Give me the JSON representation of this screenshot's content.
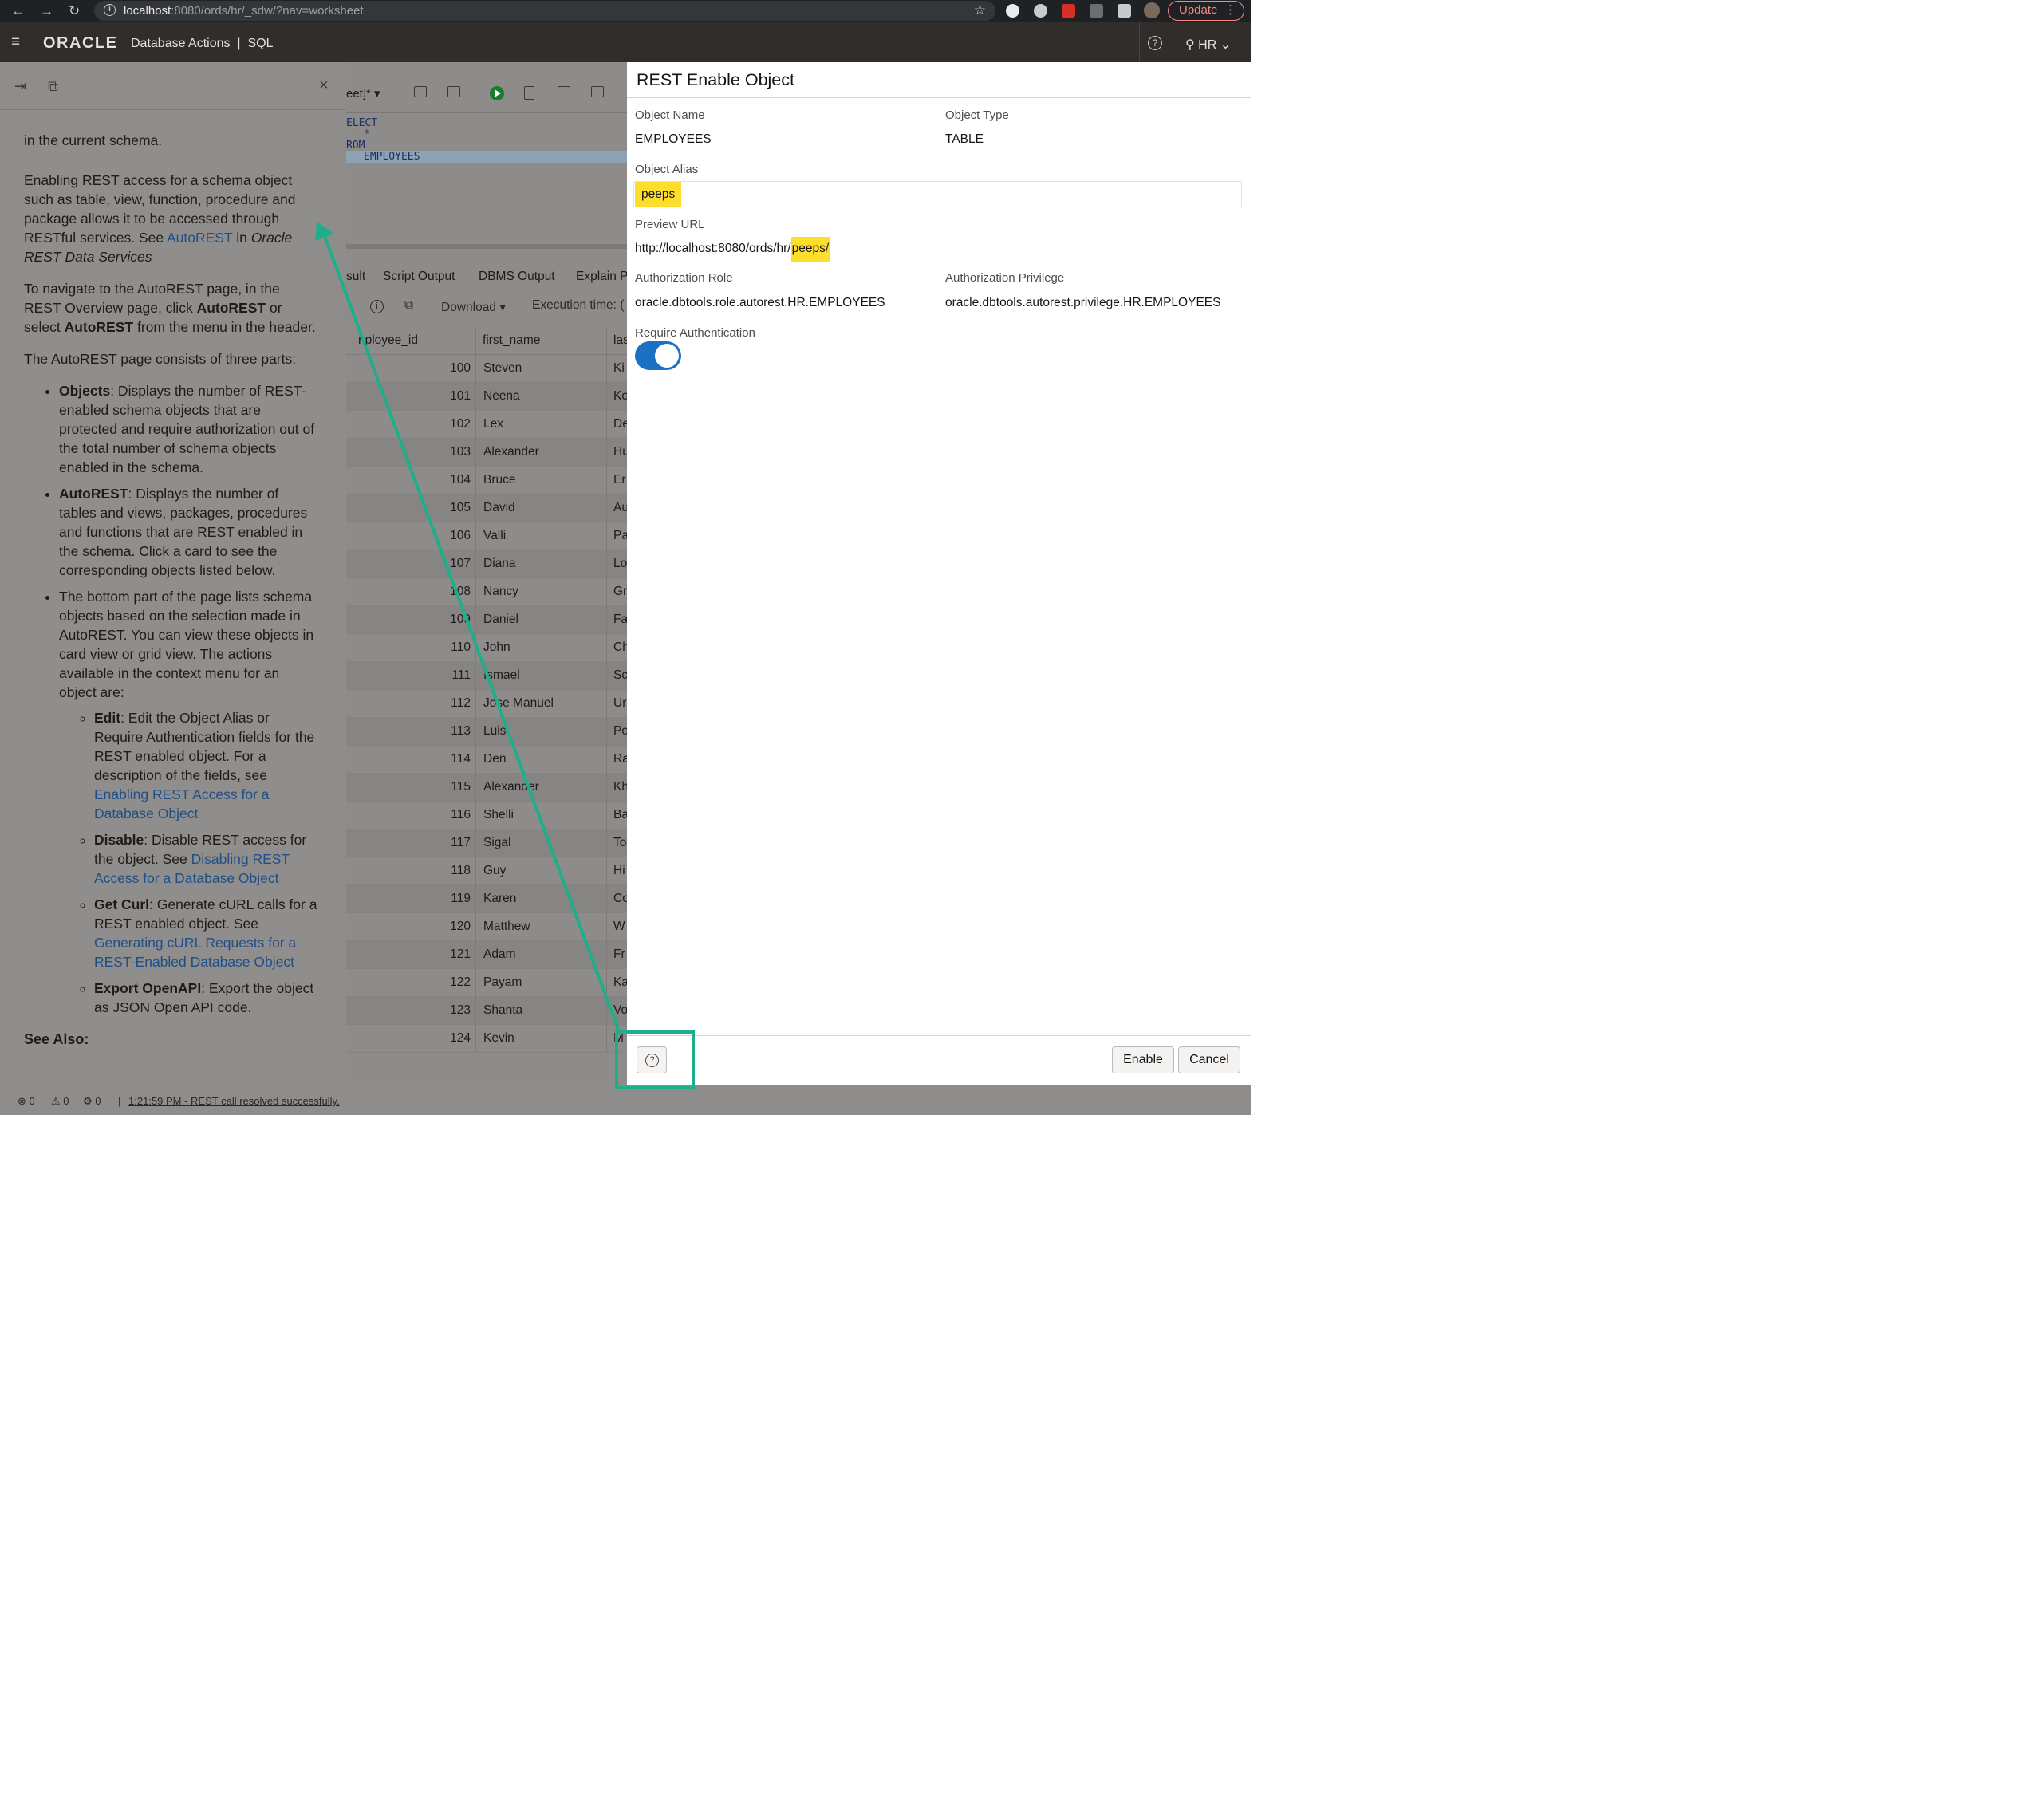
{
  "browser": {
    "url_host": "localhost",
    "url_rest": ":8080/ords/hr/_sdw/?nav=worksheet",
    "update_label": "Update"
  },
  "app": {
    "logo": "ORACLE",
    "product": "Database Actions",
    "section": "SQL",
    "user": "HR"
  },
  "help_panel": {
    "cut_line": "in the current schema.",
    "p1_a": "Enabling REST access for a schema object such as table, view, function, procedure and package allows it to be accessed through RESTful services. See ",
    "p1_link": "AutoREST",
    "p1_b": " in ",
    "p1_em": "Oracle REST Data Services",
    "p2_a": "To navigate to the AutoREST page, in the REST Overview page, click ",
    "p2_b1": "AutoREST",
    "p2_c": " or select ",
    "p2_b2": "AutoREST",
    "p2_d": " from the menu in the header.",
    "p3": "The AutoREST page consists of three parts:",
    "li1_b": "Objects",
    "li1": ": Displays the number of REST-enabled schema objects that are protected and require authorization out of the total number of schema objects enabled in the schema.",
    "li2_b": "AutoREST",
    "li2": ": Displays the number of tables and views, packages, procedures and functions that are REST enabled in the schema. Click a card to see the corresponding objects listed below.",
    "li3": "The bottom part of the page lists schema objects based on the selection made in AutoREST. You can view these objects in card view or grid view. The actions available in the context menu for an object are:",
    "sub1_b": "Edit",
    "sub1": ": Edit the Object Alias or Require Authentication fields for the REST enabled object. For a description of the fields, see ",
    "sub1_link": "Enabling REST Access for a Database Object",
    "sub2_b": "Disable",
    "sub2": ": Disable REST access for the object. See ",
    "sub2_link": "Disabling REST Access for a Database Object",
    "sub3_b": "Get Curl",
    "sub3": ": Generate cURL calls for a REST enabled object. See ",
    "sub3_link": "Generating cURL Requests for a REST-Enabled Database Object",
    "sub4_b": "Export OpenAPI",
    "sub4": ": Export the object as JSON Open API code.",
    "see_also": "See Also:"
  },
  "worksheet": {
    "tab_label": "eet]*",
    "code": [
      "ELECT",
      "*",
      "ROM",
      "EMPLOYEES"
    ],
    "result_tabs": [
      "sult",
      "Script Output",
      "DBMS Output",
      "Explain P"
    ],
    "download_label": "Download",
    "exec_time_label": "Execution time: (",
    "columns": [
      "nployee_id",
      "first_name",
      "las"
    ],
    "rows": [
      {
        "id": "100",
        "name": "Steven",
        "last": "Ki"
      },
      {
        "id": "101",
        "name": "Neena",
        "last": "Ko"
      },
      {
        "id": "102",
        "name": "Lex",
        "last": "De"
      },
      {
        "id": "103",
        "name": "Alexander",
        "last": "Hu"
      },
      {
        "id": "104",
        "name": "Bruce",
        "last": "Er"
      },
      {
        "id": "105",
        "name": "David",
        "last": "Au"
      },
      {
        "id": "106",
        "name": "Valli",
        "last": "Pa"
      },
      {
        "id": "107",
        "name": "Diana",
        "last": "Lo"
      },
      {
        "id": "108",
        "name": "Nancy",
        "last": "Gr"
      },
      {
        "id": "109",
        "name": "Daniel",
        "last": "Fa"
      },
      {
        "id": "110",
        "name": "John",
        "last": "Ch"
      },
      {
        "id": "111",
        "name": "Ismael",
        "last": "Sc"
      },
      {
        "id": "112",
        "name": "Jose Manuel",
        "last": "Ur"
      },
      {
        "id": "113",
        "name": "Luis",
        "last": "Po"
      },
      {
        "id": "114",
        "name": "Den",
        "last": "Ra"
      },
      {
        "id": "115",
        "name": "Alexander",
        "last": "Kh"
      },
      {
        "id": "116",
        "name": "Shelli",
        "last": "Ba"
      },
      {
        "id": "117",
        "name": "Sigal",
        "last": "To"
      },
      {
        "id": "118",
        "name": "Guy",
        "last": "Hi"
      },
      {
        "id": "119",
        "name": "Karen",
        "last": "Co"
      },
      {
        "id": "120",
        "name": "Matthew",
        "last": "W"
      },
      {
        "id": "121",
        "name": "Adam",
        "last": "Fr"
      },
      {
        "id": "122",
        "name": "Payam",
        "last": "Ka"
      },
      {
        "id": "123",
        "name": "Shanta",
        "last": "Vo"
      },
      {
        "id": "124",
        "name": "Kevin",
        "last": "M"
      }
    ]
  },
  "dialog": {
    "title": "REST Enable Object",
    "object_name_label": "Object Name",
    "object_name": "EMPLOYEES",
    "object_type_label": "Object Type",
    "object_type": "TABLE",
    "alias_label": "Object Alias",
    "alias_value": "peeps",
    "preview_url_label": "Preview URL",
    "preview_url_base": "http://localhost:8080/ords/hr/",
    "preview_url_alias": "peeps/",
    "auth_role_label": "Authorization Role",
    "auth_role": "oracle.dbtools.role.autorest.HR.EMPLOYEES",
    "auth_priv_label": "Authorization Privilege",
    "auth_priv": "oracle.dbtools.autorest.privilege.HR.EMPLOYEES",
    "require_auth_label": "Require Authentication",
    "require_auth_on": true,
    "enable_label": "Enable",
    "cancel_label": "Cancel"
  },
  "status": {
    "errors": "0",
    "warnings": "0",
    "tasks": "0",
    "message": "1:21:59 PM - REST call resolved successfully."
  },
  "annotation_color": "#1fae8c"
}
